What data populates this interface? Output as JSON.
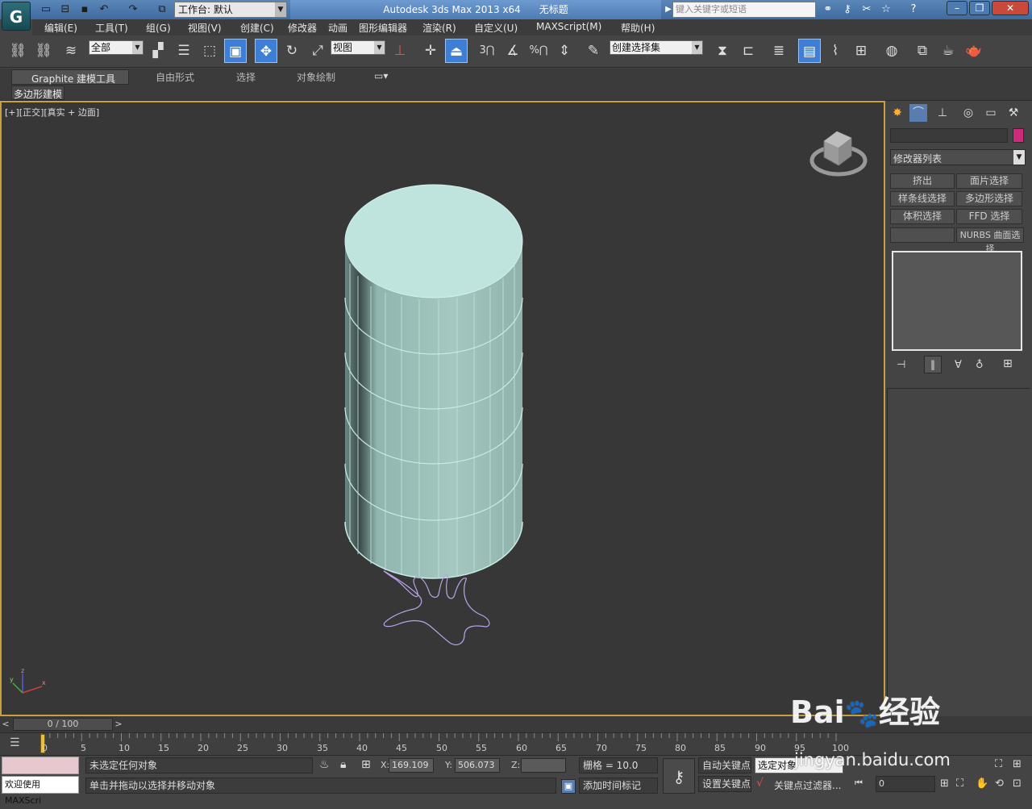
{
  "titlebar": {
    "workspace": "工作台: 默认",
    "app_name": "Autodesk 3ds Max  2013 x64",
    "doc_title": "无标题",
    "search_placeholder": "键入关键字或短语"
  },
  "menu": [
    "编辑(E)",
    "工具(T)",
    "组(G)",
    "视图(V)",
    "创建(C)",
    "修改器",
    "动画",
    "图形编辑器",
    "渲染(R)",
    "自定义(U)",
    "MAXScript(M)",
    "帮助(H)"
  ],
  "toolbar": {
    "selection_filter": "全部",
    "ref_coord": "视图",
    "named_selection": "创建选择集",
    "snap_3": "3",
    "angle_snap": "%"
  },
  "ribbon": {
    "tabs": [
      "Graphite 建模工具",
      "自由形式",
      "选择",
      "对象绘制"
    ],
    "sub": "多边形建模"
  },
  "viewport": {
    "label_prefix": "[+][",
    "label_view": "正交",
    "label_shading": "][真实 + 边面]",
    "cylinder_color": "#bfe4dd",
    "spline_color": "#b9a4e8",
    "gizmo_x": "x",
    "gizmo_y": "y",
    "gizmo_z": "z"
  },
  "command_panel": {
    "modifier_list": "修改器列表",
    "object_color": "#cc2a7a",
    "buttons": [
      "挤出",
      "面片选择",
      "样条线选择",
      "多边形选择",
      "体积选择",
      "FFD 选择",
      "",
      "NURBS 曲面选择"
    ]
  },
  "timeline": {
    "frame": "0 / 100",
    "ticks": [
      "0",
      "5",
      "10",
      "15",
      "20",
      "25",
      "30",
      "35",
      "40",
      "45",
      "50",
      "55",
      "60",
      "65",
      "70",
      "75",
      "80",
      "85",
      "90",
      "95",
      "100"
    ]
  },
  "status": {
    "welcome": "欢迎使用 MAXScri",
    "selected": "未选定任何对象",
    "prompt": "单击并拖动以选择并移动对象",
    "x_label": "X:",
    "x_value": "169.109",
    "y_label": "Y:",
    "y_value": "506.073",
    "z_label": "Z:",
    "z_value": "",
    "grid": "栅格 = 10.0",
    "add_time_tag": "添加时间标记",
    "auto_key": "自动关键点",
    "set_key": "设置关键点",
    "selected_object": "选定对象",
    "key_filters": "关键点过滤器...",
    "frame_value": "0"
  },
  "watermark": {
    "brand": "Bai",
    "brand_cn": "经验",
    "url": "jingyan.baidu.com"
  }
}
